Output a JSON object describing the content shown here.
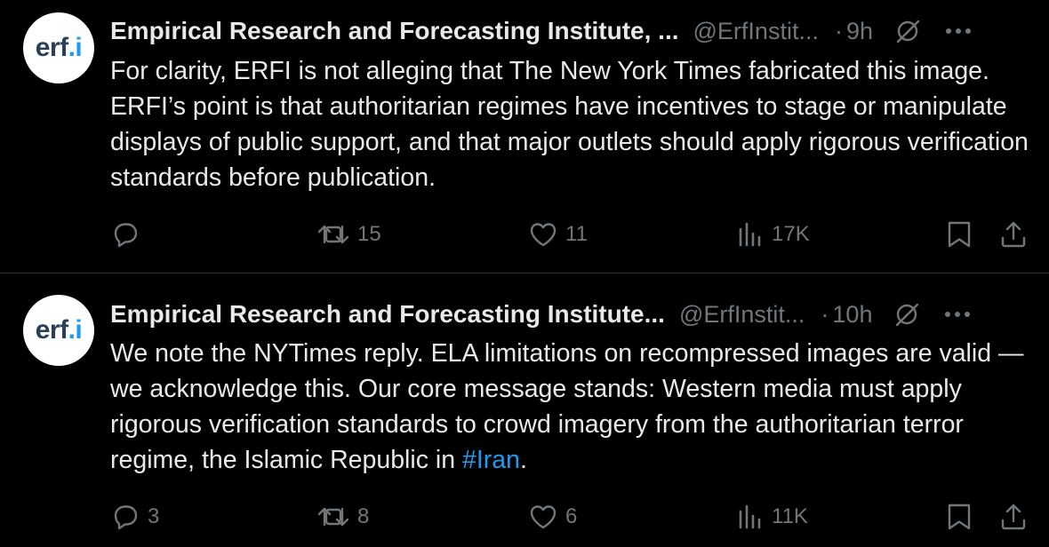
{
  "tweets": [
    {
      "avatar_text": "erf",
      "avatar_dot": ".i",
      "display_name": "Empirical Research and Forecasting Institute, ...",
      "handle": "@ErfInstit...",
      "separator": "·",
      "time": "9h",
      "text": "For clarity, ERFI is not alleging that The New York Times fabricated this image. ERFI’s point is that authoritarian regimes have incentives to stage or manipulate displays of public support, and that major outlets should apply rigorous verification standards before publication.",
      "hashtag": "",
      "text_after": "",
      "replies": "",
      "retweets": "15",
      "likes": "11",
      "views": "17K"
    },
    {
      "avatar_text": "erf",
      "avatar_dot": ".i",
      "display_name": "Empirical Research and Forecasting Institute...",
      "handle": "@ErfInstit...",
      "separator": "·",
      "time": "10h",
      "text": "We note the NYTimes reply. ELA limitations on recompressed images are valid — we acknowledge this. Our core message stands: Western media must apply rigorous verification standards to crowd imagery from the authoritarian terror regime, the Islamic Republic in ",
      "hashtag": "#Iran",
      "text_after": ".",
      "replies": "3",
      "retweets": "8",
      "likes": "6",
      "views": "11K"
    }
  ],
  "colors": {
    "background": "#000000",
    "text": "#e7e9ea",
    "muted": "#71767b",
    "link": "#1d9bf0",
    "divider": "#2f3336"
  },
  "icons": [
    "reply-icon",
    "retweet-icon",
    "like-icon",
    "views-icon",
    "bookmark-icon",
    "share-icon",
    "grok-icon",
    "more-icon"
  ]
}
